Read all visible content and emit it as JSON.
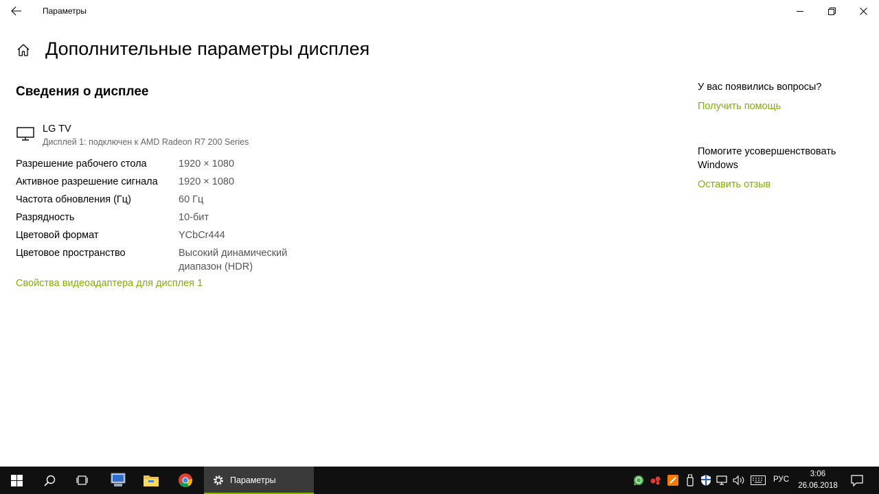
{
  "window": {
    "title": "Параметры"
  },
  "header": {
    "title": "Дополнительные параметры дисплея"
  },
  "section": {
    "title": "Сведения о дисплее"
  },
  "display": {
    "name": "LG TV",
    "subtitle": "Дисплей 1: подключен к AMD Radeon R7 200 Series"
  },
  "properties": [
    {
      "label": "Разрешение рабочего стола",
      "value": "1920 × 1080"
    },
    {
      "label": "Активное разрешение сигнала",
      "value": "1920 × 1080"
    },
    {
      "label": "Частота обновления (Гц)",
      "value": "60 Гц"
    },
    {
      "label": "Разрядность",
      "value": "10-бит"
    },
    {
      "label": "Цветовой формат",
      "value": "YCbCr444"
    },
    {
      "label": "Цветовое пространство",
      "value": "Высокий динамический диапазон (HDR)"
    }
  ],
  "adapter_link": "Свойства видеоадаптера для дисплея 1",
  "aside": {
    "question": "У вас появились вопросы?",
    "help_link": "Получить помощь",
    "improve": "Помогите усовершенствовать Windows",
    "feedback_link": "Оставить отзыв"
  },
  "taskbar": {
    "active_app_label": "Параметры",
    "language": "РУС",
    "time": "3:06",
    "date": "26.06.2018"
  },
  "colors": {
    "accent": "#7eb000",
    "taskbar": "#101010"
  }
}
